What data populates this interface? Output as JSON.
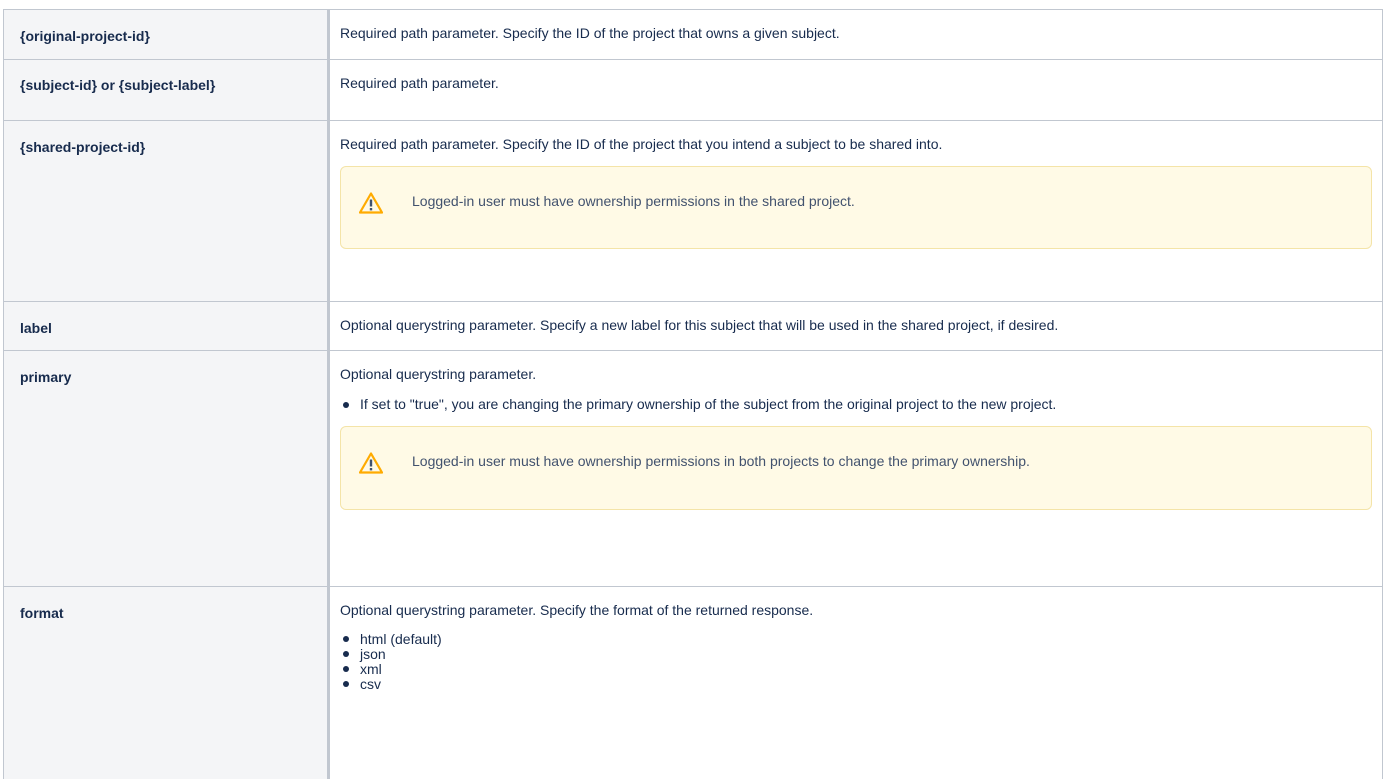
{
  "rows": [
    {
      "name": "{original-project-id}",
      "description": "Required path parameter. Specify the ID of the project that owns a given subject."
    },
    {
      "name": "{subject-id} or {subject-label}",
      "description": "Required path parameter."
    },
    {
      "name": "{shared-project-id}",
      "description": "Required path parameter. Specify the ID of the project that you intend a subject to be shared into.",
      "warning": "Logged-in user must have ownership permissions in the shared project."
    },
    {
      "name": "label",
      "description": "Optional querystring parameter. Specify a new label for this subject that will be used in the shared project, if desired."
    },
    {
      "name": "primary",
      "description": "Optional querystring parameter.",
      "bullets": [
        "If set to \"true\", you are changing the primary ownership of the subject from the original project to the new project."
      ],
      "warning": "Logged-in user must have ownership permissions in both projects to change the primary ownership."
    },
    {
      "name": "format",
      "description": "Optional querystring parameter. Specify the format of the returned response.",
      "bullets": [
        "html (default)",
        "json",
        "xml",
        "csv"
      ]
    }
  ],
  "icons": {
    "warning": "warning-triangle-icon"
  },
  "colors": {
    "warning_background": "#fffae6",
    "warning_border": "#f4e4a8",
    "warning_icon": "#ffab00",
    "header_cell_background": "#f4f5f7",
    "border": "#c1c7d0",
    "text": "#172b4d"
  }
}
